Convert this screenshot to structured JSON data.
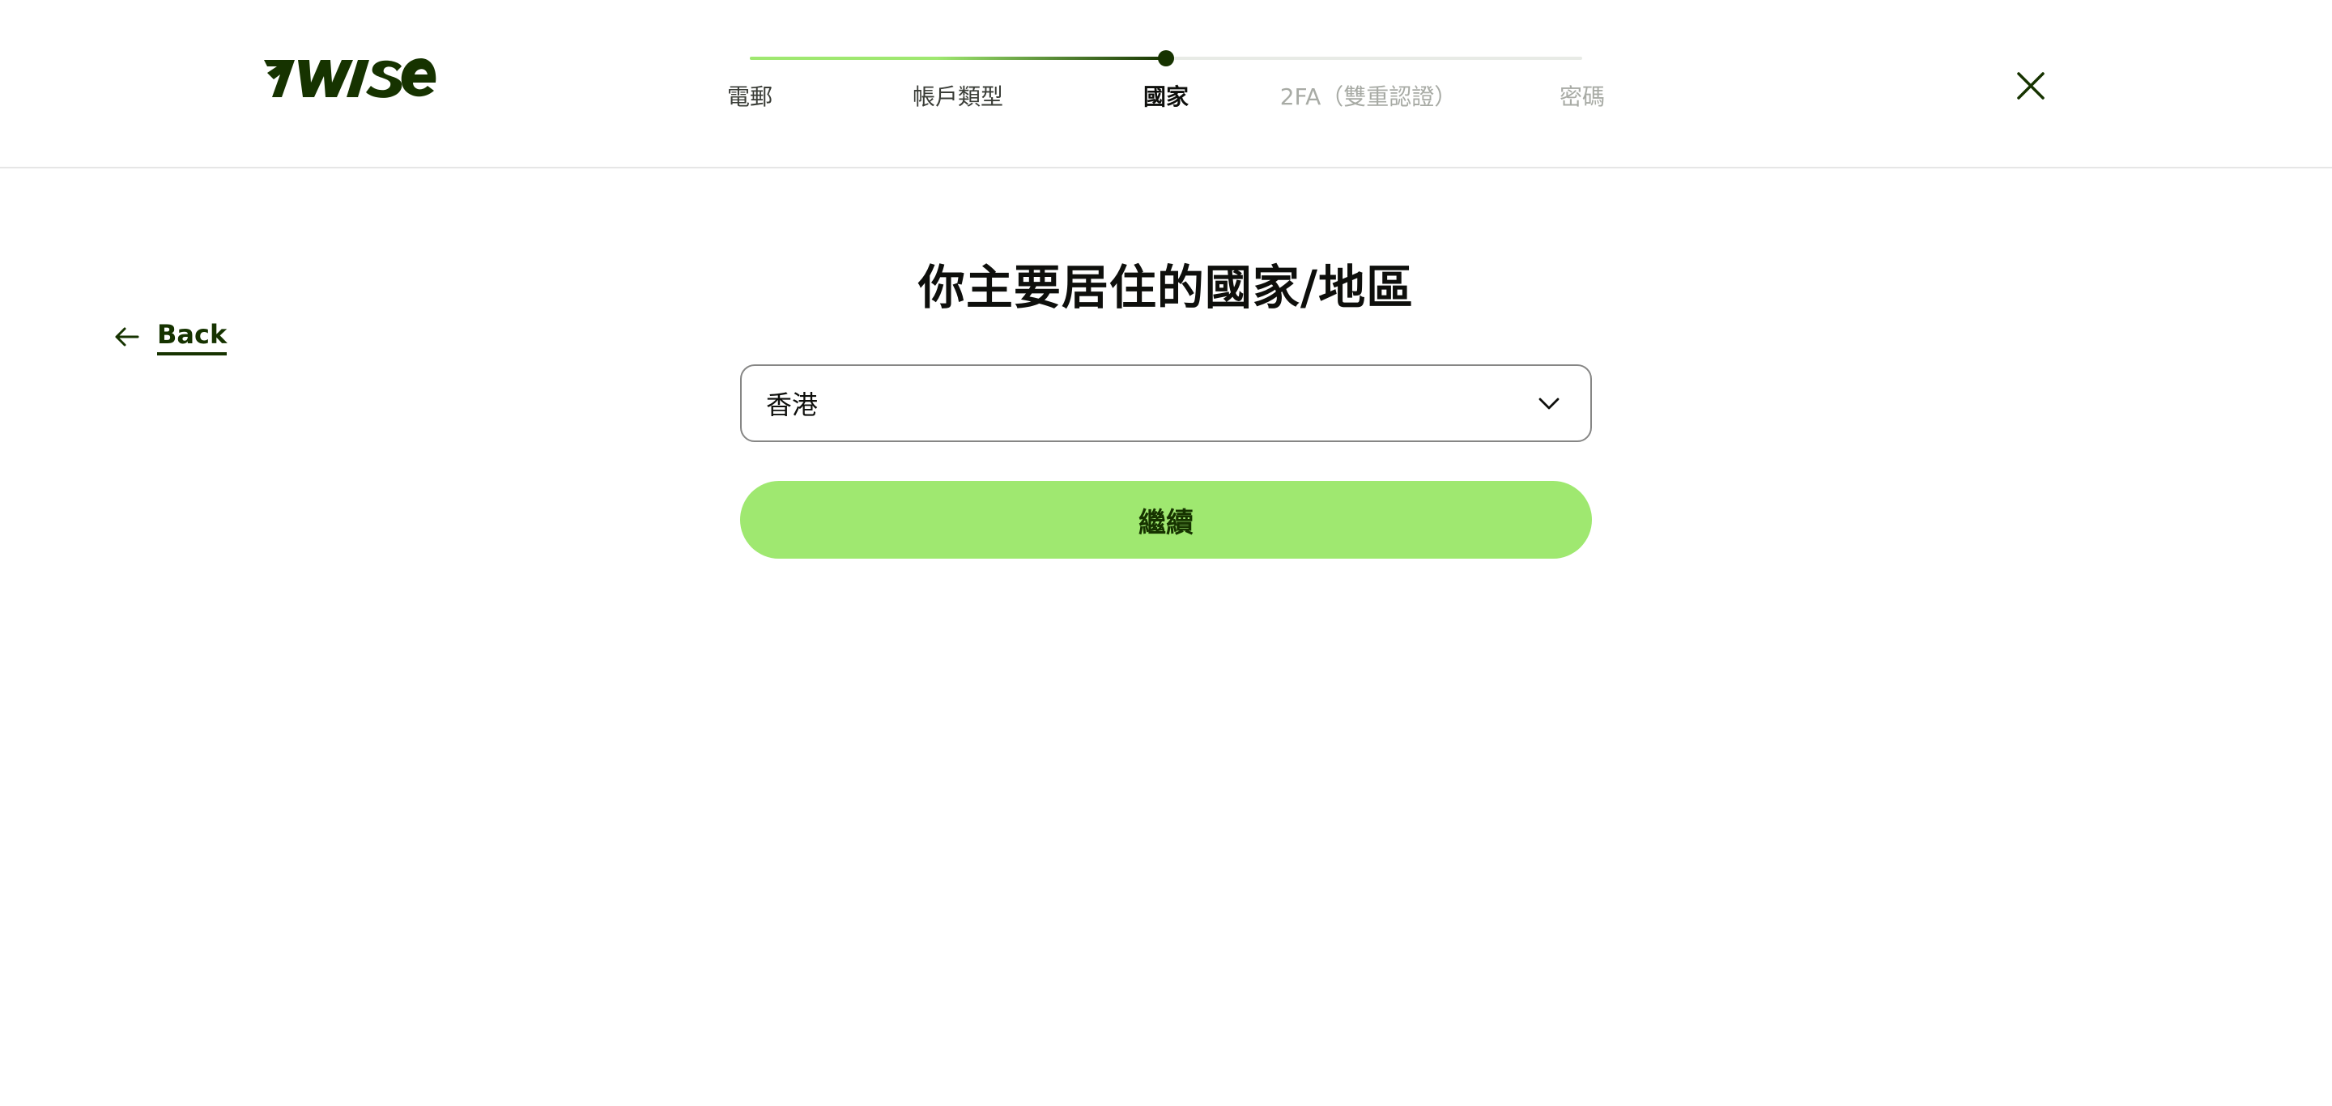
{
  "brand": {
    "name": "WISE",
    "dark_green": "#163300",
    "bright_green": "#9fe870"
  },
  "stepper": {
    "progress": 0.5,
    "steps": [
      {
        "label": "電郵",
        "state": "done"
      },
      {
        "label": "帳戶類型",
        "state": "done"
      },
      {
        "label": "國家",
        "state": "current"
      },
      {
        "label": "2FA（雙重認證）",
        "state": "todo"
      },
      {
        "label": "密碼",
        "state": "todo"
      }
    ]
  },
  "header": {
    "close_icon": "close-icon"
  },
  "back": {
    "label": "Back",
    "icon": "arrow-left-icon"
  },
  "main": {
    "title": "你主要居住的國家/地區",
    "country_select": {
      "value": "香港",
      "icon": "chevron-down-icon"
    },
    "continue_label": "繼續"
  }
}
